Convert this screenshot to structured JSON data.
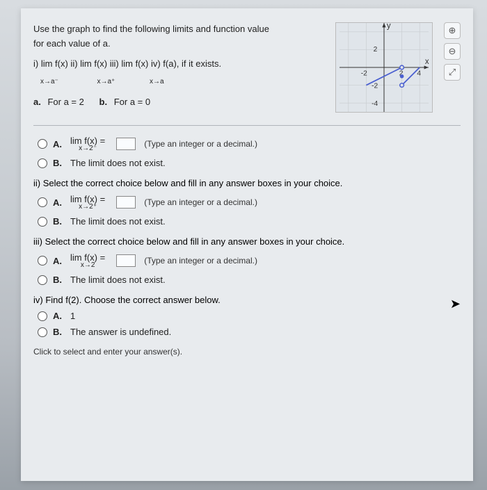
{
  "header": {
    "intro_line1": "Use the graph to find the following limits and function value",
    "intro_line2": "for each value of a.",
    "limits_prefix": "i)  lim  f(x)   ii)   lim  f(x)   iii)  lim  f(x)   iv) f(a), if it exists.",
    "approach_left": "x→a⁻",
    "approach_right": "x→a⁺",
    "approach_both": "x→a",
    "part_a_label": "a.",
    "part_a_text": "For a = 2",
    "part_b_label": "b.",
    "part_b_text": "For a = 0"
  },
  "icons": {
    "zoom_in": "⊕",
    "zoom_out": "⊖",
    "expand": "⤢"
  },
  "choices": {
    "i": {
      "A": {
        "label": "A.",
        "prefix": "lim  f(x) =",
        "sub": "x→2⁻",
        "hint": "(Type an integer or a decimal.)"
      },
      "B": {
        "label": "B.",
        "text": "The limit does not exist."
      }
    },
    "ii": {
      "instruction": "ii)  Select the correct choice below and fill in any answer boxes in your choice.",
      "A": {
        "label": "A.",
        "prefix": "lim  f(x) =",
        "sub": "x→2⁺",
        "hint": "(Type an integer or a decimal.)"
      },
      "B": {
        "label": "B.",
        "text": "The limit does not exist."
      }
    },
    "iii": {
      "instruction": "iii)  Select the correct choice below and fill in any answer boxes in your choice.",
      "A": {
        "label": "A.",
        "prefix": "lim  f(x) =",
        "sub": "x→2",
        "hint": "(Type an integer or a decimal.)"
      },
      "B": {
        "label": "B.",
        "text": "The limit does not exist."
      }
    },
    "iv": {
      "instruction": "iv)  Find f(2). Choose the correct answer below.",
      "A": {
        "label": "A.",
        "text": "1"
      },
      "B": {
        "label": "B.",
        "text": "The answer is undefined."
      }
    }
  },
  "footer": "Click to select and enter your answer(s).",
  "chart_data": {
    "type": "line",
    "xlabel": "x",
    "ylabel": "y",
    "xlim": [
      -4,
      4
    ],
    "ylim": [
      -4,
      4
    ],
    "x_ticks": [
      -2,
      2,
      4
    ],
    "y_ticks": [
      -4,
      -2,
      2
    ],
    "segments": [
      {
        "from": [
          -2,
          -2
        ],
        "to": [
          2,
          0
        ],
        "end_open": true
      },
      {
        "from": [
          2,
          -2
        ],
        "to": [
          4,
          0
        ],
        "start_open": true
      }
    ],
    "points": [
      {
        "x": 2,
        "y": -1,
        "filled": true,
        "color": "#4a5fd0"
      }
    ]
  }
}
